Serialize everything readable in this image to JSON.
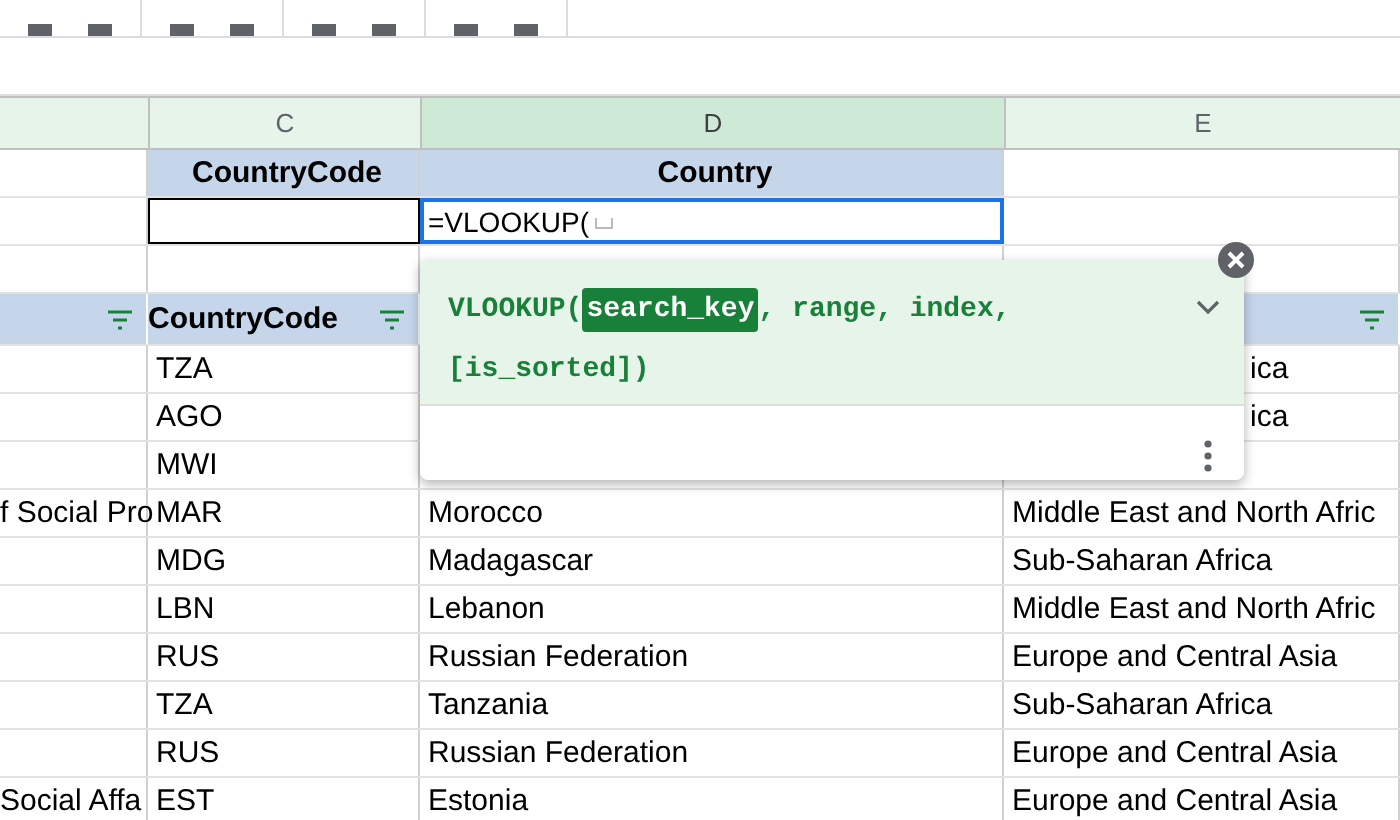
{
  "column_headers": [
    {
      "label": "C",
      "selected": false
    },
    {
      "label": "D",
      "selected": true
    },
    {
      "label": "E",
      "selected": false
    }
  ],
  "lookup": {
    "headers": [
      "CountryCode",
      "Country"
    ],
    "input_value": "=VLOOKUP("
  },
  "table": {
    "columns": [
      {
        "filter": true
      },
      {
        "label": "CountryCode",
        "filter": true
      },
      {
        "filter": true
      }
    ],
    "rows": [
      {
        "country_code": "TZA",
        "region_fragment": "ica"
      },
      {
        "country_code": "AGO",
        "region_fragment": "ica"
      },
      {
        "country_code": "MWI"
      },
      {
        "column_1": "f Social Pro",
        "country_code": "MAR",
        "country": "Morocco",
        "region": "Middle East and North Afric"
      },
      {
        "country_code": "MDG",
        "country": "Madagascar",
        "region": "Sub-Saharan Africa"
      },
      {
        "country_code": "LBN",
        "country": "Lebanon",
        "region": "Middle East and North Afric"
      },
      {
        "country_code": "RUS",
        "country": "Russian Federation",
        "region": "Europe and Central Asia"
      },
      {
        "country_code": "TZA",
        "country": "Tanzania",
        "region": "Sub-Saharan Africa"
      },
      {
        "country_code": "RUS",
        "country": "Russian Federation",
        "region": "Europe and Central Asia"
      },
      {
        "column_1": "Social Affa",
        "country_code": "EST",
        "country": "Estonia",
        "region": "Europe and Central Asia"
      }
    ]
  },
  "formula_help": {
    "function": "VLOOKUP(",
    "active_argument": "search_key",
    "rest": ", range, index, [is_sorted])"
  }
}
